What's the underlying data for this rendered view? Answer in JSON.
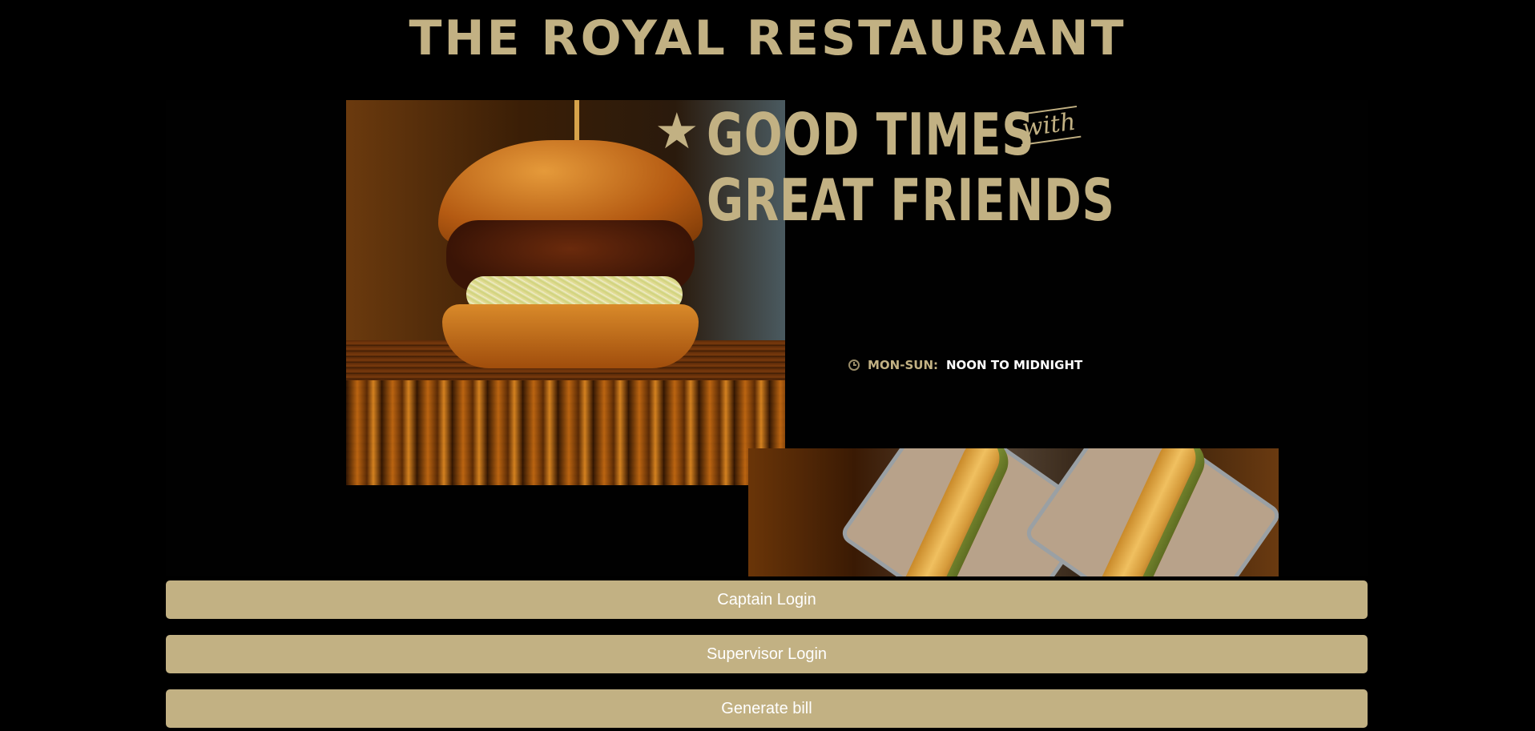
{
  "header": {
    "title": "THE ROYAL RESTAURANT"
  },
  "banner": {
    "headline_line1": "GOOD TIMES",
    "headline_with": "with",
    "headline_line2": "GREAT FRIENDS",
    "hours_days": "MON-SUN:",
    "hours_time": "NOON TO MIDNIGHT",
    "icons": [
      "star-icon",
      "clock-icon"
    ]
  },
  "actions": {
    "captain_login": "Captain Login",
    "supervisor_login": "Supervisor Login",
    "generate_bill": "Generate bill"
  },
  "colors": {
    "background": "#000000",
    "accent": "#c2b183",
    "button_text": "#ffffff"
  }
}
